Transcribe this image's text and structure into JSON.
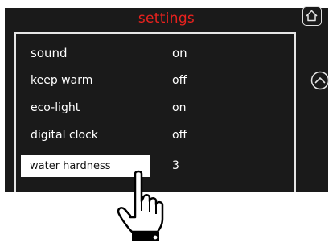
{
  "header": {
    "title": "settings"
  },
  "colors": {
    "title": "#e8221e",
    "screen_bg": "#1a1a1a",
    "text": "#ffffff",
    "selected_bg": "#ffffff"
  },
  "settings": [
    {
      "label": "sound",
      "value": "on"
    },
    {
      "label": "keep warm",
      "value": "off"
    },
    {
      "label": "eco-light",
      "value": "on"
    },
    {
      "label": "digital clock",
      "value": "off"
    },
    {
      "label": "water hardness",
      "value": "3"
    }
  ],
  "selected_item": "water hardness",
  "icons": {
    "home": "home-icon",
    "up": "chevron-up-icon",
    "hand": "pointing-hand-icon"
  }
}
